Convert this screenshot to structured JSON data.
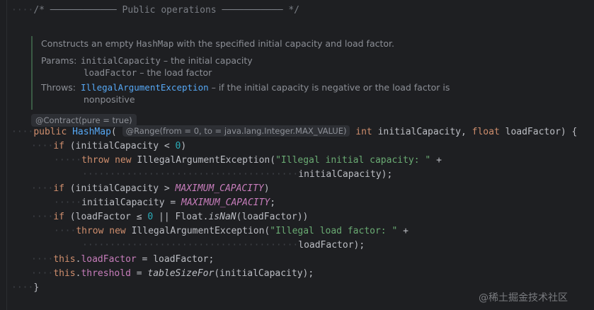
{
  "comment": {
    "open": "/*",
    "dashes_left": "────────────",
    "title": "Public operations",
    "dashes_right": "───────────",
    "close": "*/"
  },
  "doc": {
    "summary_pre": "Constructs an empty ",
    "summary_code": "HashMap",
    "summary_post": " with the specified initial capacity and load factor.",
    "params_label": "Params:",
    "param1_name": "initialCapacity",
    "param1_desc": " – the initial capacity",
    "param2_name": "loadFactor",
    "param2_desc": " – the load factor",
    "throws_label": "Throws:",
    "throws_type": "IllegalArgumentException",
    "throws_desc1": " – if the initial capacity is negative or the load factor is",
    "throws_desc2": "nonpositive"
  },
  "annotation": "@Contract(pure = true)",
  "code": {
    "kw_public": "public",
    "ctor_name": "HashMap",
    "paren_open": "(",
    "range_hint": "@Range(from = 0, to = java.lang.Integer.MAX_VALUE)",
    "kw_int": "int",
    "p1": " initialCapacity, ",
    "kw_float": "float",
    "p2": " loadFactor) {",
    "kw_if": "if",
    "if1_a": " (initialCapacity < ",
    "zero": "0",
    "close_paren": ")",
    "kw_throw": "throw",
    "kw_new": "new",
    "iae": " IllegalArgumentException(",
    "str1": "\"Illegal initial capacity: \"",
    "plus": " +",
    "cont1": "initialCapacity);",
    "if2_a": " (initialCapacity > ",
    "max_cap": "MAXIMUM_CAPACITY",
    "assign_a": "initialCapacity = ",
    "semicolon": ";",
    "if3_a": " (loadFactor ",
    "le": "≤",
    "or": "||",
    "float_cls": " Float.",
    "isnan": "isNaN",
    "if3_b": "(loadFactor))",
    "str2": "\"Illegal load factor: \"",
    "cont2": "loadFactor);",
    "kw_this": "this",
    "dot": ".",
    "f_load": "loadFactor",
    "assign_load": " = loadFactor;",
    "f_threshold": "threshold",
    "eq": " = ",
    "tsf": "tableSizeFor",
    "tsf_args": "(initialCapacity);",
    "close_brace": "}"
  },
  "watermark": "@稀土掘金技术社区"
}
